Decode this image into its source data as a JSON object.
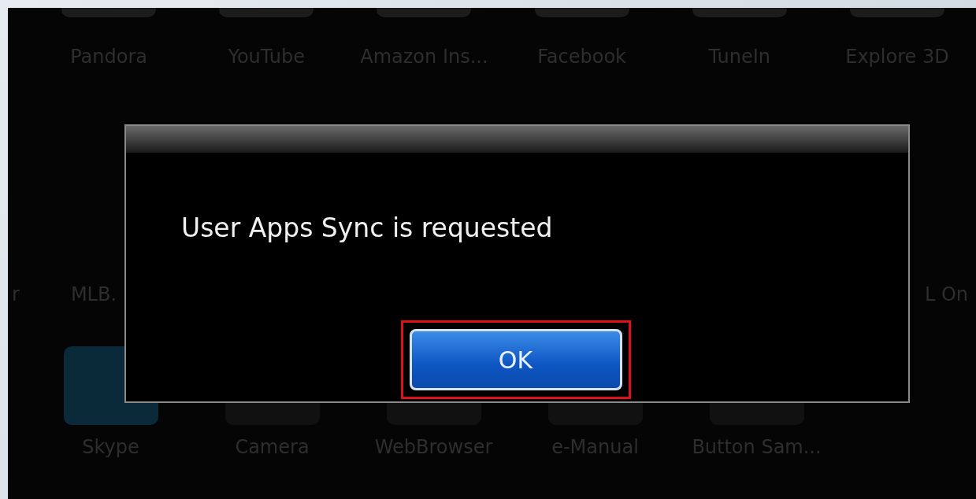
{
  "app_rows": [
    {
      "apps": [
        {
          "label": "Pandora"
        },
        {
          "label": "YouTube"
        },
        {
          "label": "Amazon Ins..."
        },
        {
          "label": "Facebook"
        },
        {
          "label": "TuneIn"
        },
        {
          "label": "Explore 3D"
        }
      ]
    },
    {
      "apps": [
        {
          "label": "r"
        },
        {
          "label": "MLB."
        },
        {
          "label": "L On"
        }
      ]
    },
    {
      "apps": [
        {
          "label": "Skype"
        },
        {
          "label": "Camera"
        },
        {
          "label": "WebBrowser"
        },
        {
          "label": "e-Manual"
        },
        {
          "label": "Button Sam..."
        }
      ]
    }
  ],
  "dialog": {
    "message": "User Apps Sync is requested",
    "buttons": [
      {
        "label": "OK",
        "focused": true
      }
    ]
  }
}
